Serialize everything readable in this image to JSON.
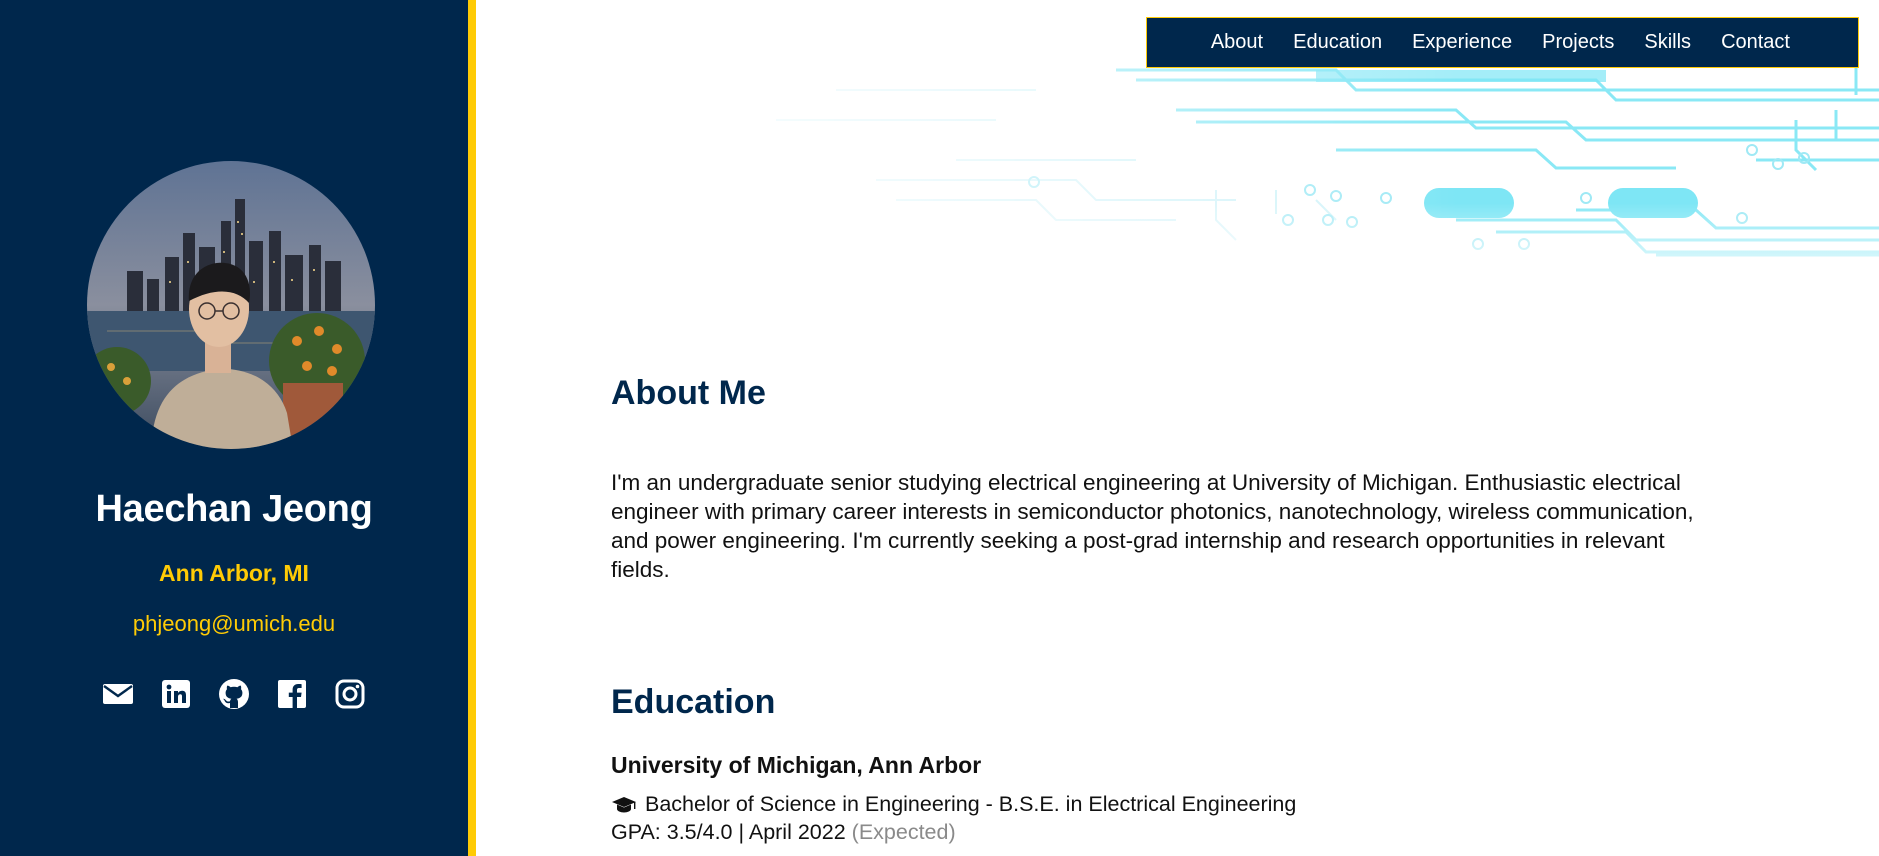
{
  "profile": {
    "name": "Haechan Jeong",
    "location": "Ann Arbor, MI",
    "email": "phjeong@umich.edu"
  },
  "socials": [
    {
      "icon": "envelope-icon"
    },
    {
      "icon": "linkedin-icon"
    },
    {
      "icon": "github-icon"
    },
    {
      "icon": "facebook-icon"
    },
    {
      "icon": "instagram-icon"
    }
  ],
  "nav": {
    "items": [
      "About",
      "Education",
      "Experience",
      "Projects",
      "Skills",
      "Contact"
    ]
  },
  "about": {
    "title": "About Me",
    "text": "I'm an undergraduate senior studying electrical engineering at University of Michigan. Enthusiastic electrical engineer with primary career interests in semiconductor photonics, nanotechnology, wireless communication, and power engineering. I'm currently seeking a post-grad internship and research opportunities in relevant fields."
  },
  "education": {
    "title": "Education",
    "school": "University of Michigan, Ann Arbor",
    "degree": "Bachelor of Science in Engineering - B.S.E. in Electrical Engineering",
    "gpa": "GPA: 3.5/4.0 | April 2022",
    "expected": "(Expected)"
  },
  "colors": {
    "navy": "#00274c",
    "maize": "#ffcb05",
    "circuit": "#7ee6f5"
  }
}
